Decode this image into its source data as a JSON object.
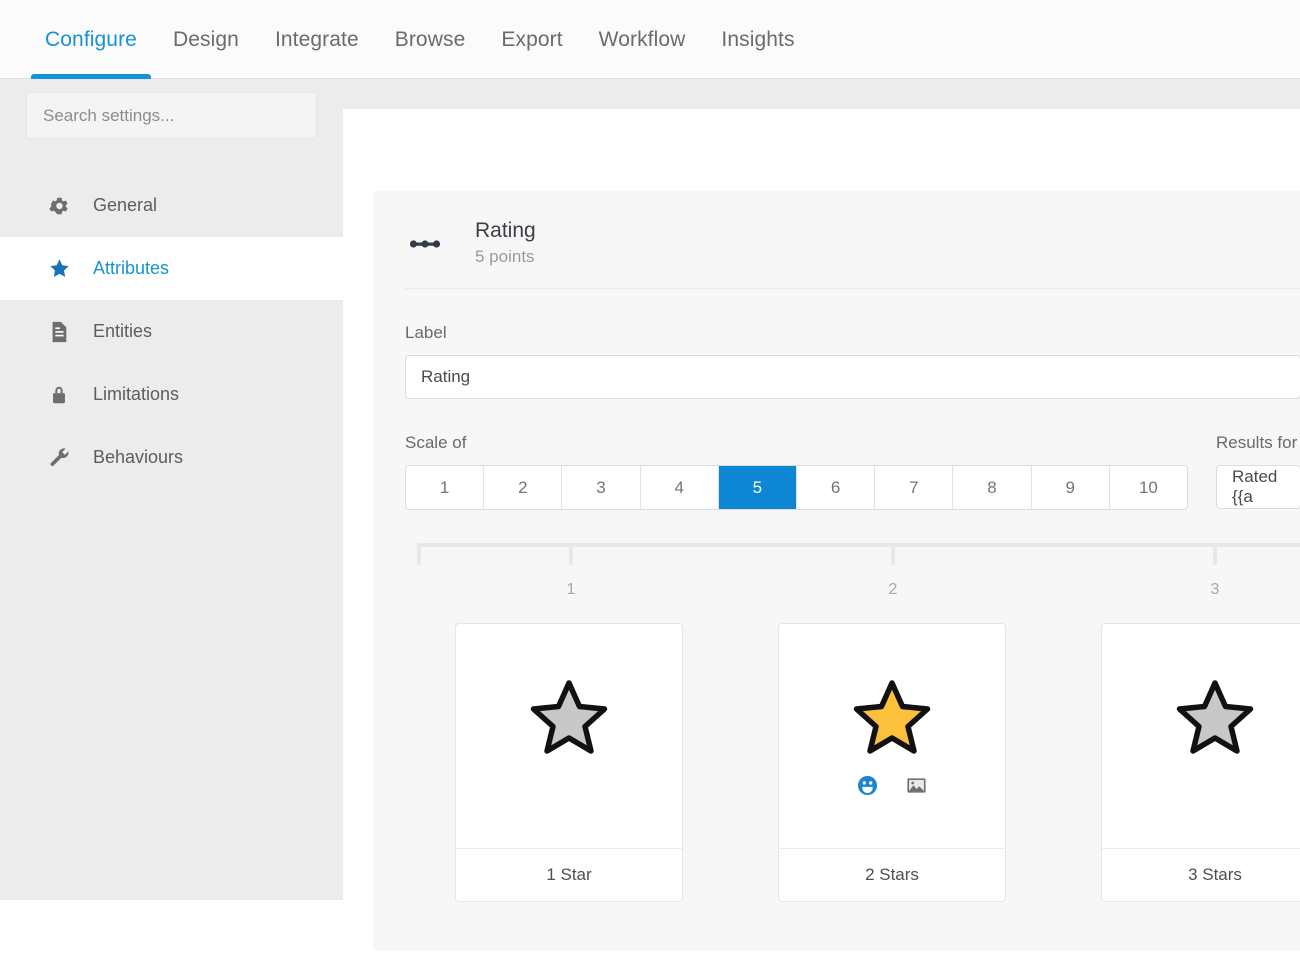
{
  "nav": {
    "active_index": 0,
    "items": [
      {
        "label": "Configure"
      },
      {
        "label": "Design"
      },
      {
        "label": "Integrate"
      },
      {
        "label": "Browse"
      },
      {
        "label": "Export"
      },
      {
        "label": "Workflow"
      },
      {
        "label": "Insights"
      }
    ]
  },
  "sidebar": {
    "search": {
      "placeholder": "Search settings...",
      "value": ""
    },
    "active_index": 1,
    "items": [
      {
        "label": "General",
        "icon": "gear-icon"
      },
      {
        "label": "Attributes",
        "icon": "star-icon"
      },
      {
        "label": "Entities",
        "icon": "document-icon"
      },
      {
        "label": "Limitations",
        "icon": "lock-icon"
      },
      {
        "label": "Behaviours",
        "icon": "wrench-icon"
      }
    ]
  },
  "panel": {
    "icon": "scale-dots-icon",
    "title": "Rating",
    "subtitle": "5 points",
    "label_field": {
      "label": "Label",
      "value": "Rating"
    },
    "scale_field": {
      "label": "Scale of",
      "options": [
        "1",
        "2",
        "3",
        "4",
        "5",
        "6",
        "7",
        "8",
        "9",
        "10"
      ],
      "selected": "5"
    },
    "results_field": {
      "label": "Results for",
      "value": "Rated {{a"
    },
    "ruler": {
      "ticks": [
        "1",
        "2",
        "3"
      ]
    },
    "cards": [
      {
        "caption": "1 Star",
        "star_color": "#c8c8c8",
        "icons": []
      },
      {
        "caption": "2 Stars",
        "star_color": "#fcc13c",
        "icons": [
          "emoji-icon",
          "image-icon"
        ]
      },
      {
        "caption": "3 Stars",
        "star_color": "#c8c8c8",
        "icons": []
      }
    ]
  },
  "colors": {
    "accent": "#0d86d4",
    "nav_active": "#1693d6",
    "star_filled": "#fcc13c",
    "star_empty": "#c8c8c8",
    "emoji_blue": "#1a86d0"
  }
}
